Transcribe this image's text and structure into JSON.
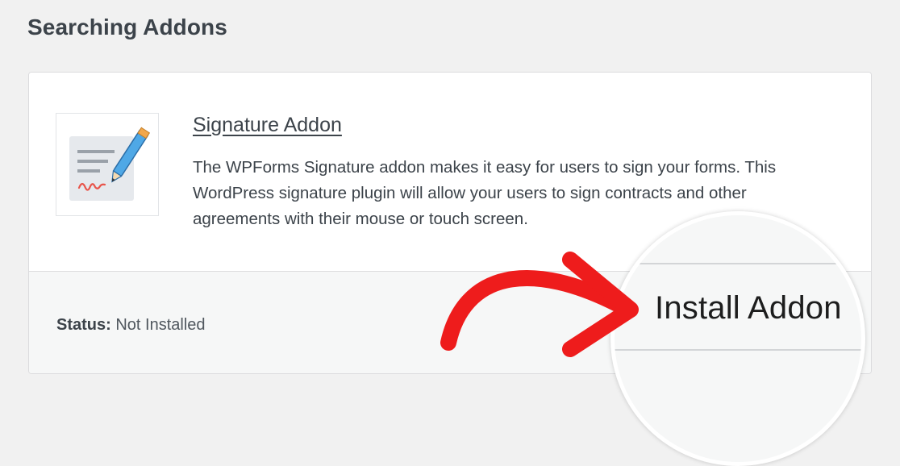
{
  "page": {
    "heading": "Searching Addons"
  },
  "addon": {
    "title": "Signature Addon",
    "description": "The WPForms Signature addon makes it easy for users to sign your forms. This WordPress signature plugin will allow your users to sign contracts and other agreements with their mouse or touch screen.",
    "icon": "signature-pen-icon",
    "status_label": "Status:",
    "status_value": "Not Installed",
    "install_label": "Install Addon"
  },
  "colors": {
    "arrow": "#ee1c1c",
    "background": "#f1f1f1",
    "card": "#ffffff",
    "footer": "#f6f7f7",
    "text": "#3c434a"
  }
}
